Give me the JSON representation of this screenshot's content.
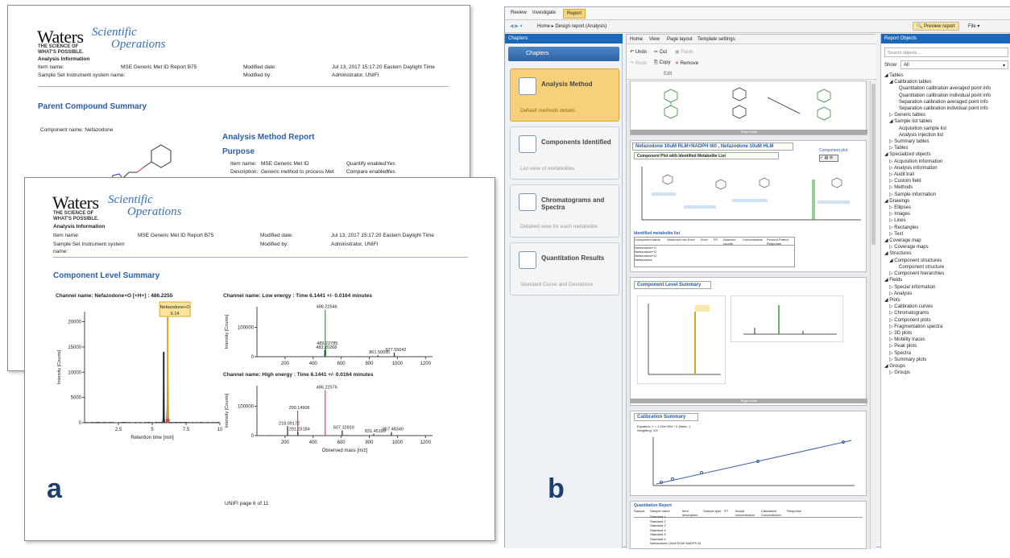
{
  "labels": {
    "a": "a",
    "b": "b"
  },
  "report_back": {
    "logo_main": "Waters",
    "logo_script1": "Scientific",
    "logo_script2": "Operations",
    "tagline1": "THE SCIENCE OF",
    "tagline2": "WHAT'S POSSIBLE.",
    "section": "Analysis Information",
    "item_name_label": "Item name:",
    "item_name": "MSE Generic Met ID Report B75",
    "modified_date_label": "Modified date:",
    "modified_date": "Jul 13, 2017 15:17:20 Eastern Daylight Time",
    "sample_set_label": "Sample Set Instrument system name:",
    "modified_by_label": "Modified by:",
    "modified_by": "Administrator, UNIFI",
    "parent_title": "Parent Compound Summary",
    "component_name": "Component name: Nefazodone",
    "method_title": "Analysis Method Report",
    "purpose": "Purpose",
    "p_item_label": "Item name:",
    "p_item": "MSE Generic Met ID",
    "p_desc_label": "Description:",
    "p_desc": "Generic method to process Met",
    "quant_label": "Quantify enabled:",
    "quant": "Yes",
    "compare_label": "Compare enabled:",
    "compare": "Yes"
  },
  "report_front": {
    "logo_main": "Waters",
    "logo_script1": "Scientific",
    "logo_script2": "Operations",
    "tagline1": "THE SCIENCE OF",
    "tagline2": "WHAT'S POSSIBLE.",
    "section": "Analysis Information",
    "item_name_label": "Item name:",
    "item_name": "MSE Generic Met ID Report B75",
    "modified_date_label": "Modified date:",
    "modified_date": "Jul 13, 2017 15:17:20 Eastern Daylight Time",
    "sample_set_label": "Sample Set Instrument system",
    "sample_set_label2": "name:",
    "modified_by_label": "Modified by:",
    "modified_by": "Administrator, UNIFI",
    "title": "Component Level Summary",
    "footer": "UNIFI page 6 of 11"
  },
  "chart_data": [
    {
      "type": "line",
      "title": "Channel name: Nefazodone+O [+H+] : 486.2255",
      "xlabel": "Retention time [min]",
      "ylabel": "Intensity [Counts]",
      "xlim": [
        0,
        10
      ],
      "ylim": [
        0,
        22000
      ],
      "xticks": [
        "2.5",
        "5",
        "7.5",
        "10"
      ],
      "yticks": [
        "0",
        "5000",
        "10000",
        "15000",
        "20000"
      ],
      "peaks": [
        {
          "x": 6.14,
          "y": 21000,
          "color": "#d9a421"
        },
        {
          "x": 5.85,
          "y": 14000,
          "color": "#222"
        }
      ],
      "annotation": {
        "name": "Nefazodone+O",
        "value": "6.14"
      }
    },
    {
      "type": "bar",
      "title": "Channel name: Low energy : Time 6.1441 +/- 0.0164 minutes",
      "xlabel": "",
      "ylabel": "Intensity [Counts]",
      "xlim": [
        0,
        1250
      ],
      "ylim": [
        0,
        170000
      ],
      "xticks": [
        "200",
        "400",
        "600",
        "800",
        "1000",
        "1200"
      ],
      "yticks": [
        "0",
        "100000"
      ],
      "peaks": [
        {
          "x": 486.22546,
          "y": 160000,
          "label": "486.22546",
          "color": "#2e9b3a"
        },
        {
          "x": 489.22785,
          "y": 35000,
          "label": "489.22785",
          "color": "#2e9b3a"
        },
        {
          "x": 483.20268,
          "y": 22000,
          "label": "483.20268",
          "color": "#222"
        },
        {
          "x": 861.50095,
          "y": 5000,
          "label": "861.50095",
          "color": "#222"
        },
        {
          "x": 977.55042,
          "y": 14000,
          "label": "977.55042",
          "color": "#222"
        }
      ]
    },
    {
      "type": "bar",
      "title": "Channel name: High energy : Time 6.1441 +/- 0.0164 minutes",
      "xlabel": "Observed mass [m/z]",
      "ylabel": "Intensity [Counts]",
      "xlim": [
        0,
        1250
      ],
      "ylim": [
        0,
        170000
      ],
      "xticks": [
        "200",
        "400",
        "600",
        "800",
        "1000",
        "1200"
      ],
      "yticks": [
        "0",
        "100000"
      ],
      "peaks": [
        {
          "x": 486.22576,
          "y": 155000,
          "label": "486.22576",
          "color": "#d9464a"
        },
        {
          "x": 290.14906,
          "y": 85000,
          "label": "290.14906",
          "color": "#d9464a"
        },
        {
          "x": 218.09172,
          "y": 32000,
          "label": "218.09172",
          "color": "#222"
        },
        {
          "x": 291.15184,
          "y": 12000,
          "label": "291.15184",
          "color": "#222"
        },
        {
          "x": 607.3281,
          "y": 18000,
          "label": "607.32810",
          "color": "#222"
        },
        {
          "x": 831.45189,
          "y": 6000,
          "label": "831.45189",
          "color": "#222"
        },
        {
          "x": 957.4834,
          "y": 12000,
          "label": "957.48340",
          "color": "#222"
        }
      ]
    }
  ],
  "app": {
    "tabs": [
      "Review",
      "Investigate",
      "Report"
    ],
    "breadcrumb": "Home ▸ Design report (Analysis)",
    "preview_btn": "Preview report",
    "file_btn": "File",
    "chapters_header": "Chapters",
    "chapters_sub": "Chapters",
    "chapters": [
      {
        "title": "Analysis Method",
        "sub": "Default methods details"
      },
      {
        "title": "Components Identified",
        "sub": "List view of metabolites"
      },
      {
        "title": "Chromatograms and Spectra",
        "sub": "Detailed view for each metabolite"
      },
      {
        "title": "Quantitation Results",
        "sub": "Standard Curve and Deviations"
      }
    ],
    "ribbon_tabs": [
      "Home",
      "View",
      "Page layout",
      "Template settings"
    ],
    "ribbon": {
      "undo": "Undo",
      "cut": "Cut",
      "paste": "Paste",
      "redo": "Redo",
      "copy": "Copy",
      "remove": "Remove",
      "edit": "Edit"
    },
    "doc": {
      "s1": "Nefazodone 10uM RLM+NADPH t60 , Nefazodone 10uM HLM",
      "s1_sub": "Component Plot with Identified Metabolite List",
      "comp_plot": "Component plot",
      "ident_list": "Identified metabolite list",
      "table_headers": [
        "Component name",
        "Observed m/z",
        "Error",
        "Error",
        "RT",
        "Detector counts",
        "Concentration",
        "Percent Parent Response"
      ],
      "table_rows": [
        "Nefazodone+O",
        "Nefazodone+O",
        "Nefazodone+O",
        "Nefazodone"
      ],
      "s2": "Component Level Summary",
      "page_break": "Page break",
      "s3": "Calibration Summary",
      "cal_line1": "Equation: Y = 1.20e+004 * X (Nefa...)",
      "cal_line2": "Weighting: 1/X",
      "quant_report": "Quantitation Report",
      "quant_headers": [
        "Sample",
        "Sample name",
        "Item description",
        "Sample type",
        "RT",
        "Actual concentration",
        "Calculated Concentration",
        "Response"
      ],
      "quant_rows": [
        "Standard 1",
        "Standard 2",
        "Standard 3",
        "Standard 4",
        "Standard 5",
        "Standard 6",
        "Nefazodone 10uM RLM+NADPH t0"
      ]
    },
    "report_objects_header": "Report Objects",
    "search_placeholder": "Search objects...",
    "show_label": "Show:",
    "show_value": "All",
    "tree": [
      {
        "l": 0,
        "t": "◢ Tables"
      },
      {
        "l": 1,
        "t": "◢ Calibration tables"
      },
      {
        "l": 3,
        "t": "Quantitation calibration averaged point info"
      },
      {
        "l": 3,
        "t": "Quantitation calibration individual point info"
      },
      {
        "l": 3,
        "t": "Separation calibration averaged point info"
      },
      {
        "l": 3,
        "t": "Separation calibration individual point info"
      },
      {
        "l": 1,
        "t": "▷ Generic tables"
      },
      {
        "l": 1,
        "t": "◢ Sample list tables"
      },
      {
        "l": 3,
        "t": "Acquisition sample list"
      },
      {
        "l": 3,
        "t": "Analysis injection list"
      },
      {
        "l": 1,
        "t": "▷ Summary tables"
      },
      {
        "l": 1,
        "t": "▷ Tables"
      },
      {
        "l": 0,
        "t": "◢ Specialized objects"
      },
      {
        "l": 1,
        "t": "▷ Acquisition information"
      },
      {
        "l": 1,
        "t": "▷ Analysis information"
      },
      {
        "l": 1,
        "t": "▷ Audit trail"
      },
      {
        "l": 1,
        "t": "▷ Custom field"
      },
      {
        "l": 1,
        "t": "▷ Methods"
      },
      {
        "l": 1,
        "t": "▷ Sample information"
      },
      {
        "l": 0,
        "t": "◢ Drawings"
      },
      {
        "l": 1,
        "t": "▷ Ellipses"
      },
      {
        "l": 1,
        "t": "▷ Images"
      },
      {
        "l": 1,
        "t": "▷ Lines"
      },
      {
        "l": 1,
        "t": "▷ Rectangles"
      },
      {
        "l": 1,
        "t": "▷ Text"
      },
      {
        "l": 0,
        "t": "◢ Coverage map"
      },
      {
        "l": 1,
        "t": "▷ Coverage maps"
      },
      {
        "l": 0,
        "t": "◢ Structures"
      },
      {
        "l": 1,
        "t": "◢ Component structures"
      },
      {
        "l": 3,
        "t": "Component structure"
      },
      {
        "l": 1,
        "t": "▷ Component hierarchies"
      },
      {
        "l": 0,
        "t": "◢ Fields"
      },
      {
        "l": 1,
        "t": "▷ Special information"
      },
      {
        "l": 1,
        "t": "▷ Analysis"
      },
      {
        "l": 0,
        "t": "◢ Plots"
      },
      {
        "l": 1,
        "t": "▷ Calibration curves"
      },
      {
        "l": 1,
        "t": "▷ Chromatograms"
      },
      {
        "l": 1,
        "t": "▷ Component plots"
      },
      {
        "l": 1,
        "t": "▷ Fragmentation spectra"
      },
      {
        "l": 1,
        "t": "▷ 3D plots"
      },
      {
        "l": 1,
        "t": "▷ Mobility traces"
      },
      {
        "l": 1,
        "t": "▷ Peak plots"
      },
      {
        "l": 1,
        "t": "▷ Spectra"
      },
      {
        "l": 1,
        "t": "▷ Summary plots"
      },
      {
        "l": 0,
        "t": "◢ Groups"
      },
      {
        "l": 1,
        "t": "▷ Groups"
      }
    ]
  }
}
